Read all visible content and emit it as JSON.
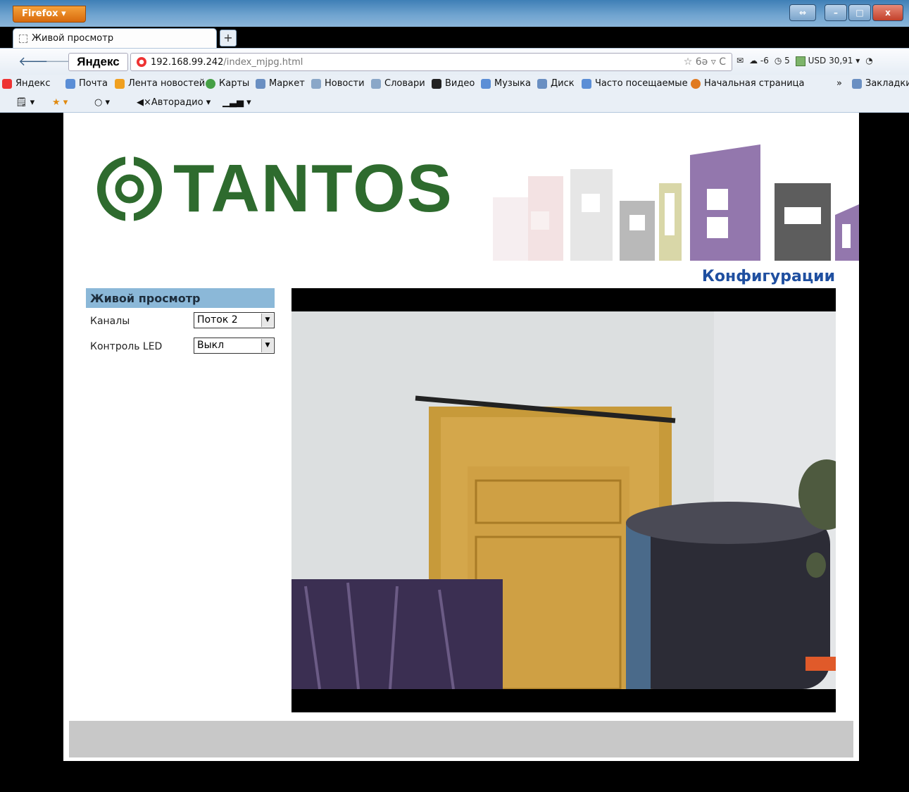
{
  "window": {
    "app_button": "Firefox ▾",
    "controls": {
      "resize": "⇔",
      "minimize": "–",
      "maximize": "□",
      "close": "x"
    }
  },
  "tab": {
    "title": "Живой просмотр",
    "new_tab": "+"
  },
  "nav": {
    "yandex_label": "Яндекс",
    "url_host": "192.168.99.242",
    "url_path": "/index_mjpg.html",
    "url_right_icons": "☆ 6ə ▿ C",
    "weather": "-6",
    "counter": "5",
    "currency": "USD 30,91"
  },
  "bookmarks": {
    "items": [
      "Яндекс",
      "Почта",
      "Лента новостей",
      "Карты",
      "Маркет",
      "Новости",
      "Словари",
      "Видео",
      "Музыка",
      "Диск",
      "Часто посещаемые",
      "Начальная страница"
    ],
    "overflow": "»",
    "bookmarks_menu": "Закладки"
  },
  "addon_bar": {
    "radio": "Авторадио"
  },
  "page": {
    "brand": "TANTOS",
    "config_link": "Конфигурации",
    "sidebar": {
      "title": "Живой просмотр",
      "channels_label": "Каналы",
      "channels_value": "Поток 2",
      "led_label": "Контроль LED",
      "led_value": "Выкл"
    }
  }
}
